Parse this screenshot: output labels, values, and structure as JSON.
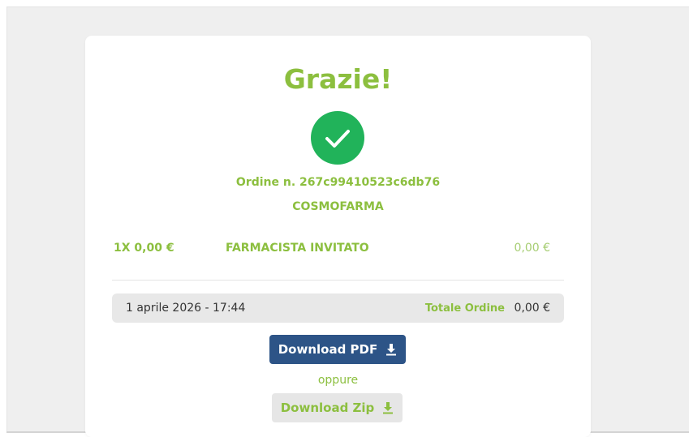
{
  "order": {
    "title": "Grazie!",
    "number_text": "Ordine n. 267c99410523c6db76",
    "company": "COSMOFARMA"
  },
  "item": {
    "qty_price": "1X 0,00 €",
    "name": "FARMACISTA INVITATO",
    "price": "0,00 €"
  },
  "summary": {
    "date": "1 aprile 2026 - 17:44",
    "total_label": "Totale Ordine",
    "total_value": "0,00 €"
  },
  "actions": {
    "download_pdf_label": "Download PDF",
    "separator": "oppure",
    "download_zip_label": "Download Zip"
  },
  "icons": {
    "success": "check-circle-icon",
    "download": "download-icon"
  },
  "colors": {
    "accent_green": "#8cbf3f",
    "success_green": "#21b35a",
    "button_blue": "#2d5487"
  }
}
